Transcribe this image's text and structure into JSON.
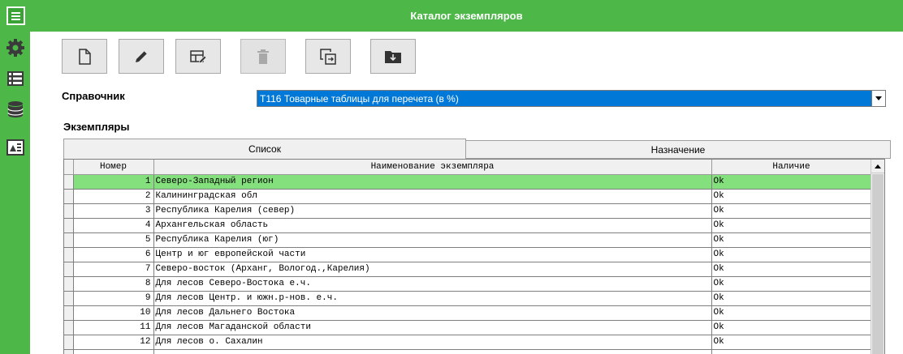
{
  "app": {
    "title": "Каталог экземпляров"
  },
  "sidebar": {
    "icons": [
      "menu-icon",
      "gear-icon",
      "list-icon",
      "database-icon",
      "report-icon"
    ]
  },
  "toolbar": {
    "buttons": [
      {
        "name": "new-document",
        "icon": "new-document-icon",
        "enabled": true
      },
      {
        "name": "edit",
        "icon": "pencil-icon",
        "enabled": true
      },
      {
        "name": "edit-table",
        "icon": "edit-table-icon",
        "enabled": true
      },
      {
        "name": "delete",
        "icon": "trash-icon",
        "enabled": false
      },
      {
        "name": "copy",
        "icon": "copy-icon",
        "enabled": true
      },
      {
        "name": "download",
        "icon": "folder-download-icon",
        "enabled": true
      }
    ]
  },
  "form": {
    "directory_label": "Справочник",
    "directory_value": "T116 Товарные таблицы для перечета (в %)",
    "instances_label": "Экземпляры"
  },
  "tabs": [
    {
      "label": "Список",
      "active": true
    },
    {
      "label": "Назначение",
      "active": false
    }
  ],
  "grid": {
    "columns": [
      "Номер",
      "Наименование экземпляра",
      "Наличие"
    ],
    "rows": [
      {
        "num": "1",
        "name": "Северо-Западный регион",
        "status": "Ok",
        "selected": true
      },
      {
        "num": "2",
        "name": "Калининградская обл",
        "status": "Ok"
      },
      {
        "num": "3",
        "name": "Республика Карелия (север)",
        "status": "Ok"
      },
      {
        "num": "4",
        "name": "Архангельская область",
        "status": "Ok"
      },
      {
        "num": "5",
        "name": "Республика Карелия (юг)",
        "status": "Ok"
      },
      {
        "num": "6",
        "name": "Центр и юг европейской части",
        "status": "Ok"
      },
      {
        "num": "7",
        "name": "Северо-восток (Арханг, Вологод.,Карелия)",
        "status": "Ok"
      },
      {
        "num": "8",
        "name": "Для лесов Северо-Востока е.ч.",
        "status": "Ok"
      },
      {
        "num": "9",
        "name": "Для лесов Центр. и южн.р-нов. е.ч.",
        "status": "Ok"
      },
      {
        "num": "10",
        "name": "Для лесов Дальнего Востока",
        "status": "Ok"
      },
      {
        "num": "11",
        "name": "Для лесов Магаданской области",
        "status": "Ok"
      },
      {
        "num": "12",
        "name": "Для лесов о. Сахалин",
        "status": "Ok"
      }
    ]
  },
  "colors": {
    "accent_green": "#4db848",
    "selected_row": "#84e07c",
    "select_highlight": "#0078d7"
  }
}
